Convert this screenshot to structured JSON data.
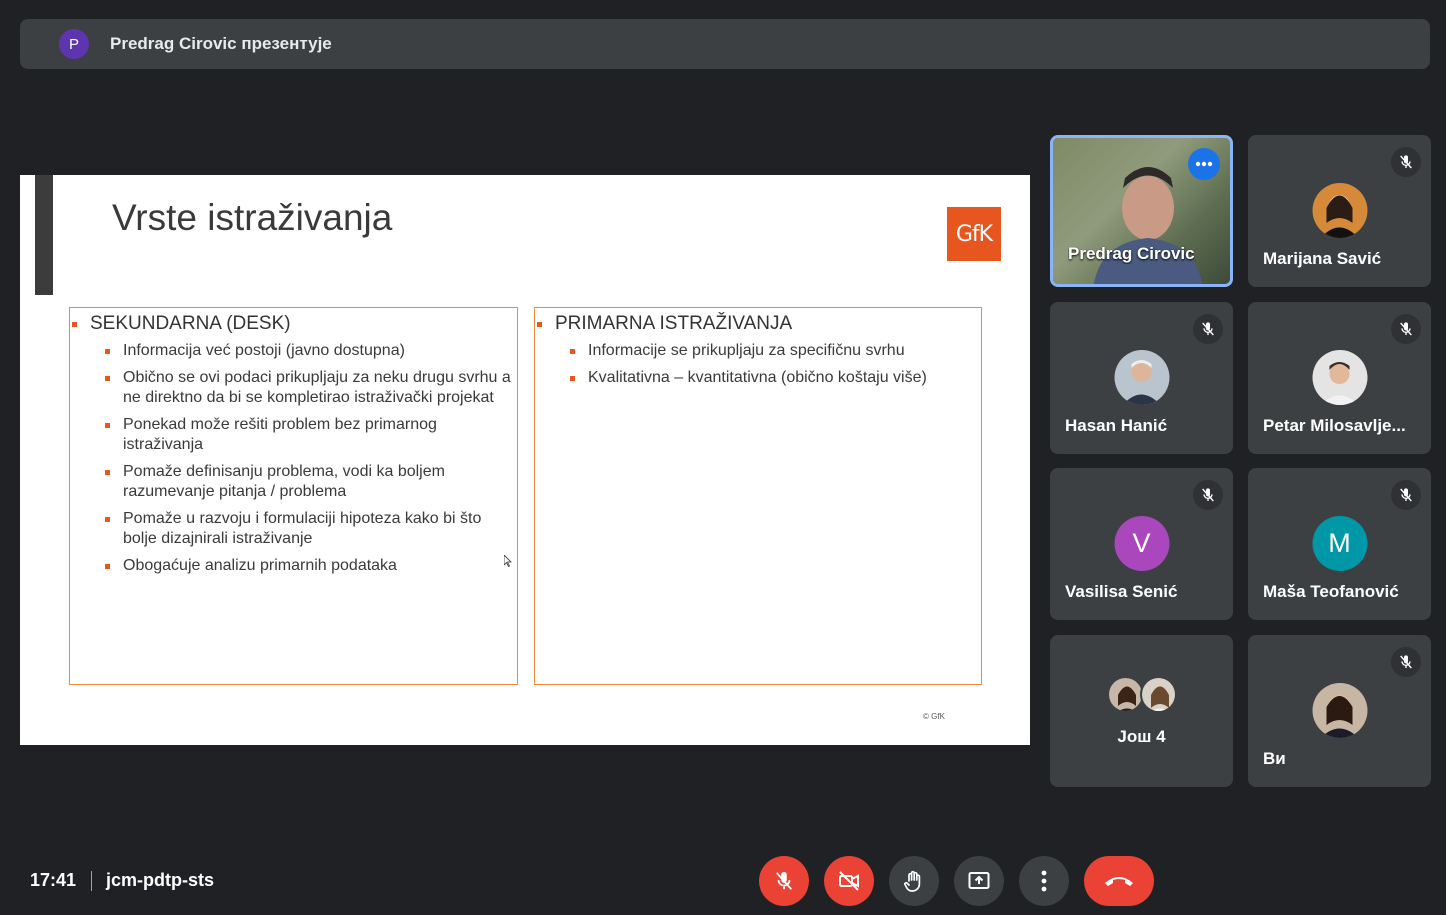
{
  "banner": {
    "avatar_letter": "P",
    "text": "Predrag Cirovic презентује"
  },
  "slide": {
    "title": "Vrste istraživanja",
    "logo": "GfK",
    "left_box": {
      "heading": "SEKUNDARNA (DESK)",
      "items": [
        "Informacija već postoji (javno dostupna)",
        "Obično se ovi podaci prikupljaju za neku drugu svrhu a ne direktno da bi se kompletirao istraživački projekat",
        "Ponekad može rešiti problem bez primarnog istraživanja",
        "Pomaže definisanju problema, vodi ka boljem razumevanje pitanja / problema",
        "Pomaže u razvoju i formulaciji hipoteza kako bi što bolje dizajnirali istraživanje",
        "Obogaćuje analizu primarnih podataka"
      ]
    },
    "right_box": {
      "heading": "PRIMARNA ISTRAŽIVANJA",
      "items": [
        "Informacije se prikupljaju za specifičnu svrhu",
        "Kvalitativna – kvantitativna (obično koštaju više)"
      ]
    },
    "copyright": "© GfK"
  },
  "participants": [
    {
      "name": "Predrag Cirovic"
    },
    {
      "name": "Marijana Savić"
    },
    {
      "name": "Hasan Hanić"
    },
    {
      "name": "Petar Milosavlje..."
    },
    {
      "name": "Vasilisa Senić",
      "letter": "V",
      "color": "#ab47bc"
    },
    {
      "name": "Maša Teofanović",
      "letter": "M",
      "color": "#0097a7"
    },
    {
      "name": "Ви"
    }
  ],
  "more_participants": "Још 4",
  "bottom": {
    "time": "17:41",
    "meeting_code": "jcm-pdtp-sts"
  },
  "colors": {
    "accent": "#ee8a3a",
    "brand": "#e8561f",
    "danger": "#ea4335",
    "tile": "#3c4043"
  }
}
